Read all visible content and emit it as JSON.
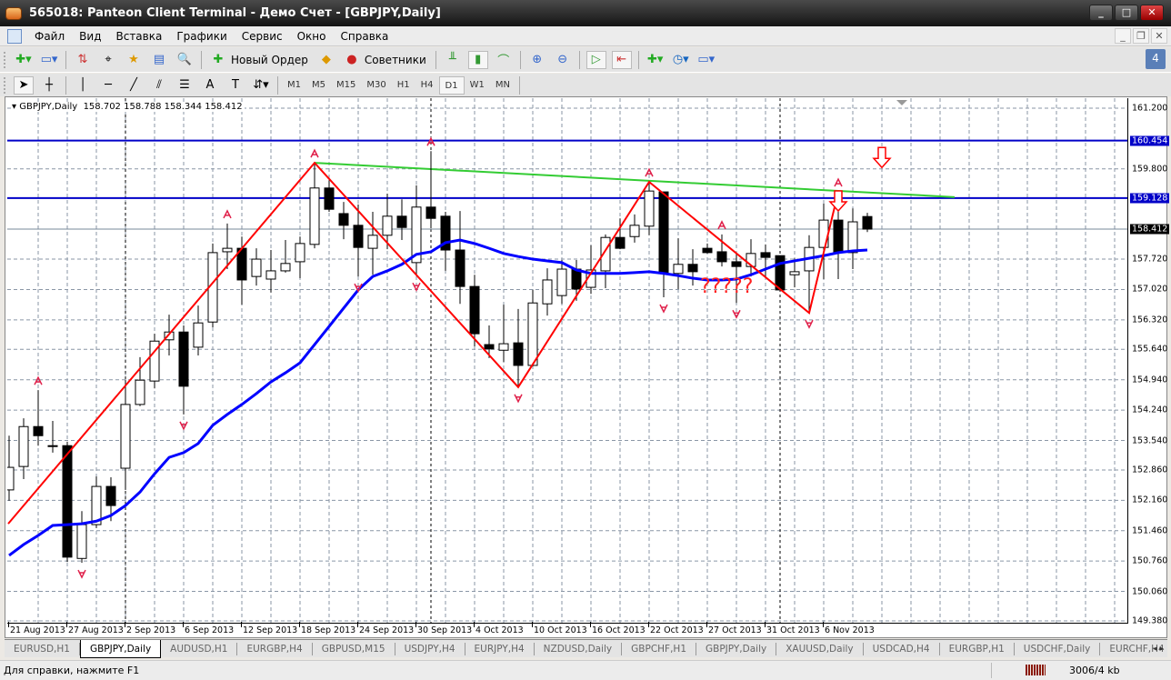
{
  "window": {
    "title": "565018: Panteon Client Terminal - Демо Счет - [GBPJPY,Daily]",
    "minimize": "_",
    "maximize": "□",
    "close": "✕"
  },
  "menu": [
    "Файл",
    "Вид",
    "Вставка",
    "Графики",
    "Сервис",
    "Окно",
    "Справка"
  ],
  "mdi": {
    "minimize": "_",
    "restore": "❐",
    "close": "✕"
  },
  "toolbar": {
    "new_order": "Новый Ордер",
    "experts": "Советники",
    "messages_count": "4"
  },
  "drawing_tools": {
    "text": "A",
    "label": "T"
  },
  "timeframes": [
    "M1",
    "M5",
    "M15",
    "M30",
    "H1",
    "H4",
    "D1",
    "W1",
    "MN"
  ],
  "active_timeframe": "D1",
  "chart": {
    "header": {
      "symbol": "GBPJPY,Daily",
      "open": "158.702",
      "high": "158.788",
      "low": "158.344",
      "close": "158.412"
    },
    "price_ticks": [
      "161.200",
      "159.800",
      "157.720",
      "157.020",
      "156.320",
      "155.640",
      "154.940",
      "154.240",
      "153.540",
      "152.860",
      "152.160",
      "151.460",
      "150.760",
      "150.060",
      "149.380"
    ],
    "hline_labels": [
      "160.454",
      "159.128"
    ],
    "current_price_label": "158.412",
    "date_labels": [
      "21 Aug 2013",
      "27 Aug 2013",
      "2 Sep 2013",
      "6 Sep 2013",
      "12 Sep 2013",
      "18 Sep 2013",
      "24 Sep 2013",
      "30 Sep 2013",
      "4 Oct 2013",
      "10 Oct 2013",
      "16 Oct 2013",
      "22 Oct 2013",
      "27 Oct 2013",
      "31 Oct 2013",
      "6 Nov 2013"
    ],
    "annotation_text": "?????"
  },
  "chart_data": {
    "type": "candlestick",
    "symbol": "GBPJPY",
    "timeframe": "Daily",
    "ylim": [
      149.38,
      161.2
    ],
    "date_label_every": 4,
    "candles_ohlc": [
      [
        152.4,
        153.65,
        152.15,
        152.92
      ],
      [
        152.94,
        154.05,
        152.65,
        153.86
      ],
      [
        153.86,
        154.7,
        153.42,
        153.65
      ],
      [
        153.42,
        153.99,
        153.26,
        153.42
      ],
      [
        153.42,
        153.51,
        150.74,
        150.85
      ],
      [
        150.82,
        151.91,
        150.72,
        151.6
      ],
      [
        151.6,
        152.71,
        151.52,
        152.48
      ],
      [
        152.48,
        152.69,
        151.68,
        152.04
      ],
      [
        152.9,
        154.93,
        152.4,
        154.37
      ],
      [
        154.37,
        155.46,
        154.33,
        154.93
      ],
      [
        154.91,
        156.0,
        154.74,
        155.83
      ],
      [
        155.86,
        156.44,
        155.5,
        156.04
      ],
      [
        156.04,
        156.19,
        154.14,
        154.79
      ],
      [
        155.69,
        156.65,
        155.5,
        156.25
      ],
      [
        156.27,
        158.08,
        156.15,
        157.87
      ],
      [
        157.89,
        158.54,
        157.49,
        157.97
      ],
      [
        157.97,
        158.24,
        156.67,
        157.24
      ],
      [
        157.32,
        157.97,
        157.11,
        157.72
      ],
      [
        157.26,
        157.93,
        156.95,
        157.45
      ],
      [
        157.45,
        158.16,
        157.41,
        157.62
      ],
      [
        157.66,
        158.24,
        157.28,
        158.08
      ],
      [
        158.06,
        159.94,
        157.97,
        159.36
      ],
      [
        159.36,
        159.54,
        158.81,
        158.87
      ],
      [
        158.77,
        159.04,
        158.18,
        158.5
      ],
      [
        158.5,
        158.98,
        157.32,
        157.99
      ],
      [
        157.97,
        158.81,
        157.36,
        158.27
      ],
      [
        158.27,
        159.23,
        157.95,
        158.71
      ],
      [
        158.71,
        159.1,
        158.16,
        158.45
      ],
      [
        157.64,
        159.42,
        157.34,
        158.92
      ],
      [
        158.92,
        160.21,
        158.43,
        158.66
      ],
      [
        158.71,
        158.81,
        157.45,
        157.93
      ],
      [
        157.93,
        158.83,
        156.69,
        157.09
      ],
      [
        157.09,
        157.36,
        155.71,
        156.0
      ],
      [
        155.75,
        156.19,
        155.44,
        155.65
      ],
      [
        155.62,
        156.67,
        155.35,
        155.77
      ],
      [
        155.79,
        156.57,
        154.77,
        155.27
      ],
      [
        155.27,
        157.01,
        155.25,
        156.71
      ],
      [
        156.69,
        157.51,
        156.42,
        157.24
      ],
      [
        156.88,
        157.7,
        156.69,
        157.49
      ],
      [
        157.49,
        157.7,
        156.76,
        157.03
      ],
      [
        157.07,
        158.04,
        156.92,
        157.47
      ],
      [
        157.45,
        158.29,
        157.05,
        158.22
      ],
      [
        158.22,
        158.66,
        157.95,
        157.97
      ],
      [
        158.24,
        158.75,
        158.1,
        158.5
      ],
      [
        158.48,
        159.5,
        158.27,
        159.29
      ],
      [
        159.27,
        159.27,
        156.84,
        157.39
      ],
      [
        157.39,
        158.2,
        157.03,
        157.6
      ],
      [
        157.6,
        157.95,
        157.11,
        157.43
      ],
      [
        157.97,
        158.08,
        157.85,
        157.87
      ],
      [
        157.89,
        158.29,
        157.55,
        157.66
      ],
      [
        157.66,
        157.87,
        156.71,
        157.55
      ],
      [
        157.55,
        158.18,
        157.32,
        157.85
      ],
      [
        157.87,
        158.06,
        157.32,
        157.76
      ],
      [
        157.8,
        157.8,
        156.97,
        157.01
      ],
      [
        157.36,
        157.74,
        157.07,
        157.43
      ],
      [
        157.45,
        158.27,
        156.48,
        157.99
      ],
      [
        157.99,
        159.0,
        157.26,
        158.62
      ],
      [
        158.62,
        159.27,
        157.26,
        157.87
      ],
      [
        157.87,
        158.89,
        157.49,
        158.58
      ],
      [
        158.702,
        158.788,
        158.344,
        158.412
      ]
    ],
    "moving_average": [
      150.89,
      151.14,
      151.35,
      151.58,
      151.6,
      151.62,
      151.68,
      151.81,
      152.04,
      152.35,
      152.77,
      153.15,
      153.26,
      153.47,
      153.89,
      154.14,
      154.37,
      154.62,
      154.89,
      155.1,
      155.33,
      155.75,
      156.17,
      156.59,
      157.01,
      157.32,
      157.45,
      157.6,
      157.83,
      157.89,
      158.1,
      158.16,
      158.08,
      157.97,
      157.85,
      157.78,
      157.72,
      157.68,
      157.64,
      157.47,
      157.39,
      157.39,
      157.39,
      157.41,
      157.43,
      157.39,
      157.34,
      157.28,
      157.24,
      157.24,
      157.26,
      157.36,
      157.49,
      157.62,
      157.68,
      157.74,
      157.8,
      157.87,
      157.91,
      157.93
    ],
    "zigzag": [
      [
        1,
        151.62
      ],
      [
        22,
        159.94
      ],
      [
        36,
        154.77
      ],
      [
        45,
        159.5
      ],
      [
        56,
        156.48
      ],
      [
        58,
        159.27
      ]
    ],
    "trendline": [
      [
        22,
        159.94
      ],
      [
        66,
        159.15
      ]
    ],
    "horizontal_levels": [
      160.454,
      159.128
    ],
    "current_price": 158.412,
    "fractals_up": [
      3,
      16,
      22,
      30,
      45,
      50,
      58
    ],
    "fractals_down": [
      6,
      13,
      25,
      29,
      36,
      46,
      51,
      56
    ],
    "period_separators": [
      9,
      30,
      54
    ],
    "signal_arrows": [
      [
        61,
        160.0
      ],
      [
        58,
        159.0
      ]
    ],
    "colors": {
      "ma": "#0000ff",
      "zigzag": "#ff0000",
      "trendline": "#33cc33",
      "levels": "#0000c8",
      "fractal": "#e0204a"
    }
  },
  "tabs": [
    "EURUSD,H1",
    "GBPJPY,Daily",
    "AUDUSD,H1",
    "EURGBP,H4",
    "GBPUSD,M15",
    "USDJPY,H4",
    "EURJPY,H4",
    "NZDUSD,Daily",
    "GBPCHF,H1",
    "GBPJPY,Daily",
    "XAUUSD,Daily",
    "USDCAD,H4",
    "EURGBP,H1",
    "USDCHF,Daily",
    "EURCHF,H4"
  ],
  "active_tab": 1,
  "status": {
    "help": "Для справки, нажмите F1",
    "memory": "3006/4 kb"
  }
}
